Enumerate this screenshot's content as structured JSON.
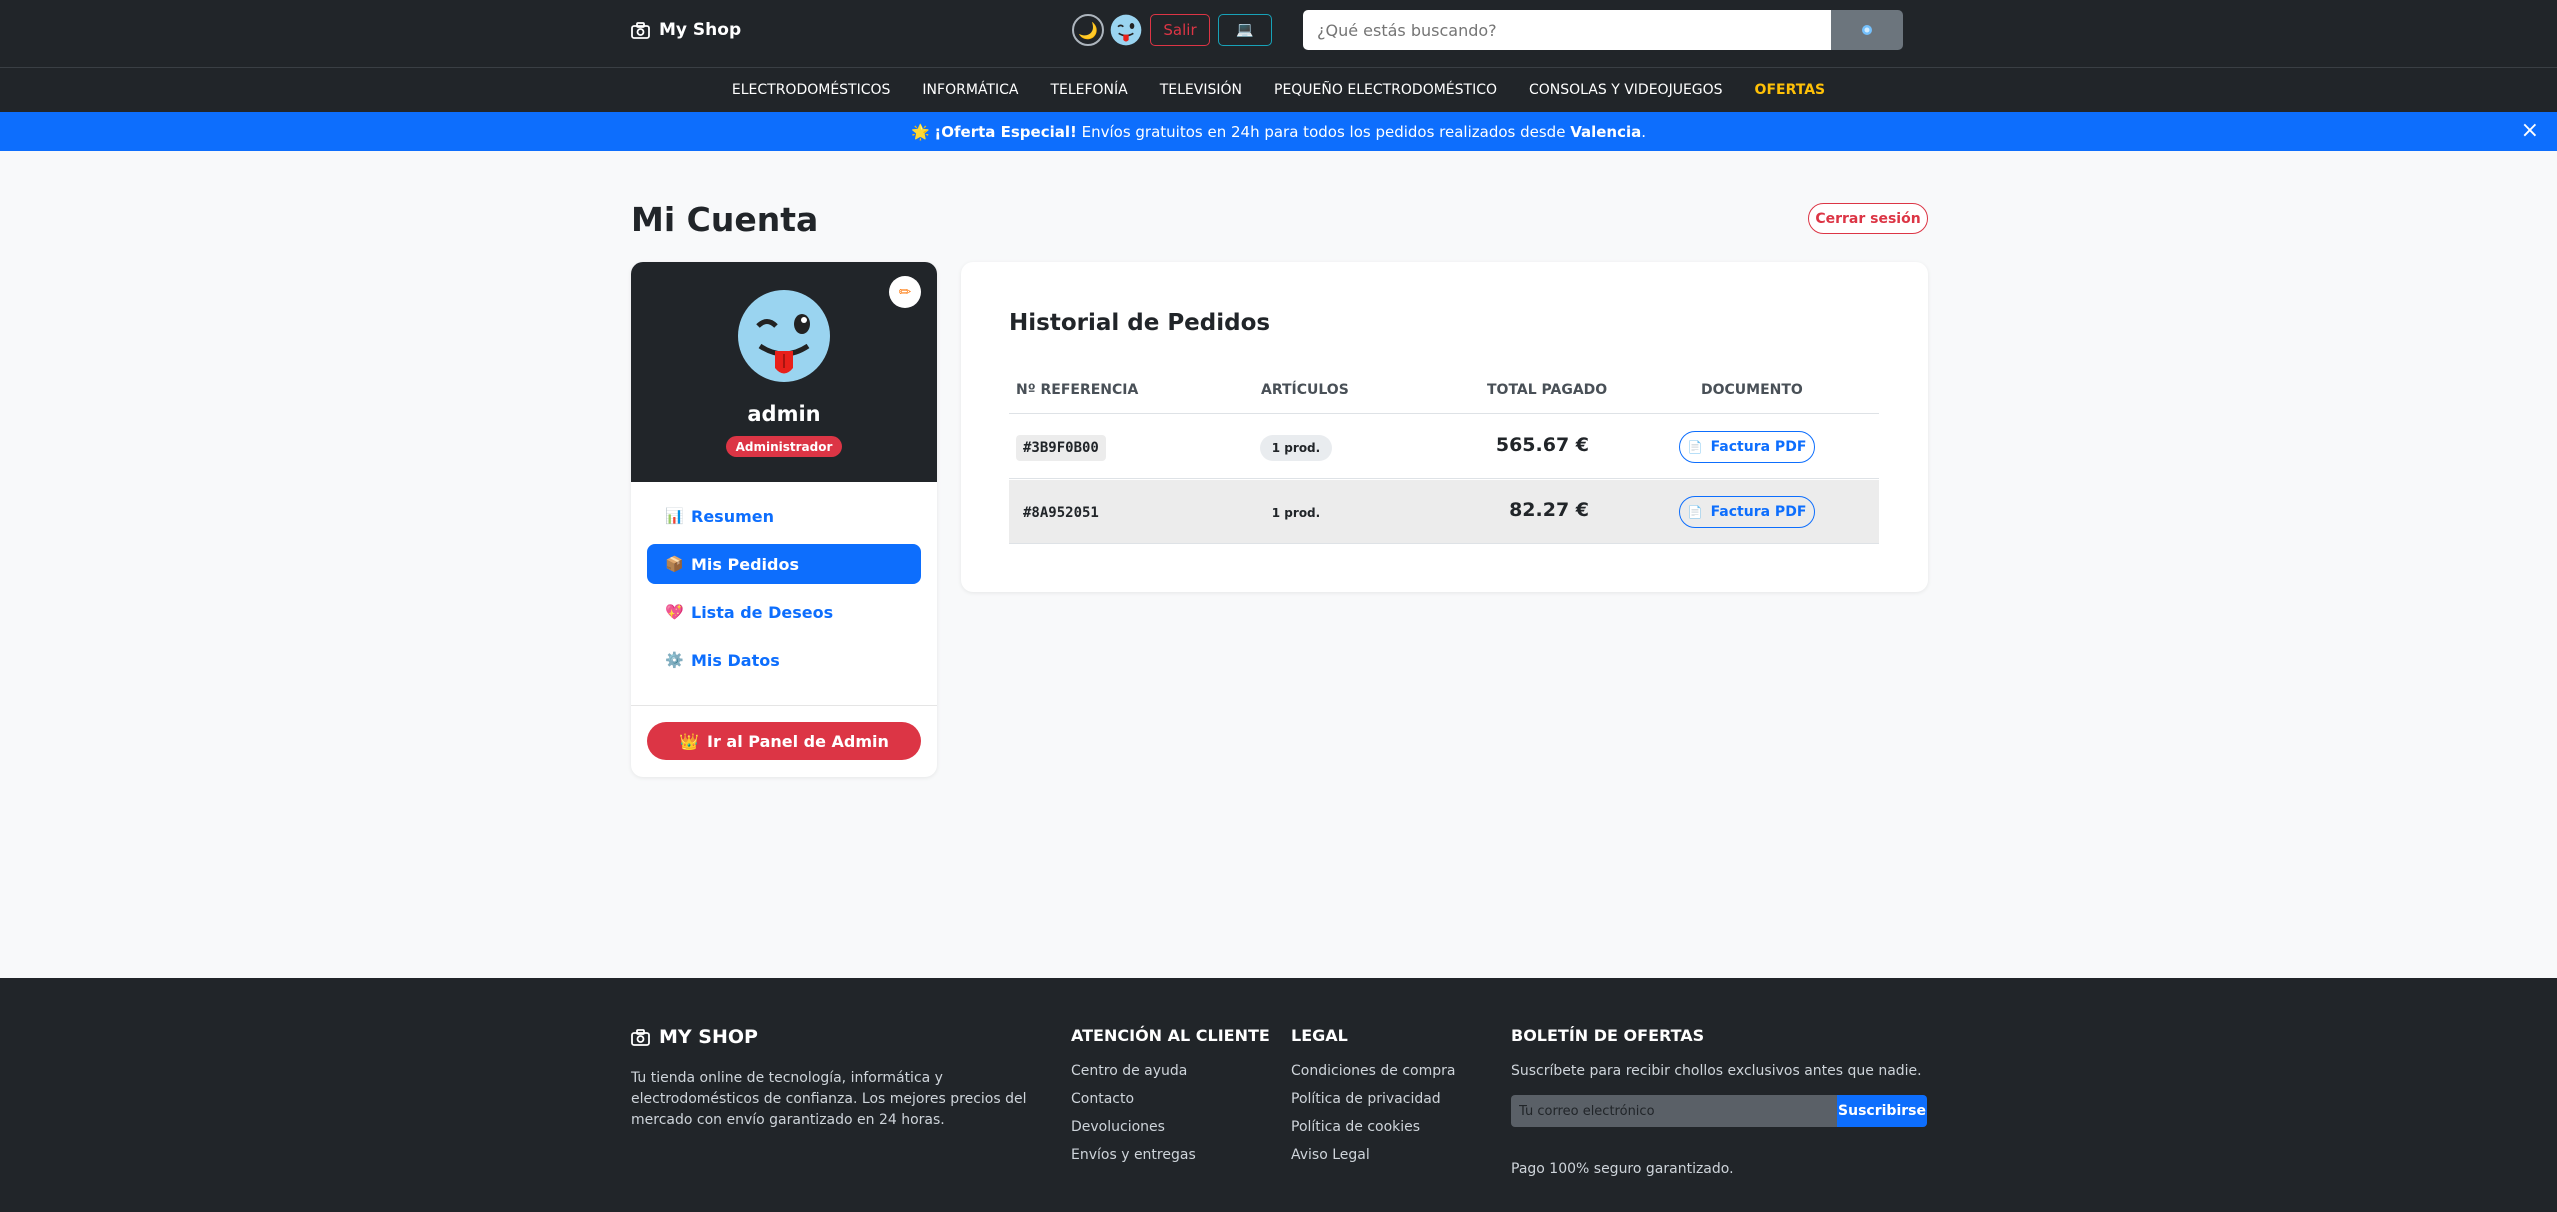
{
  "header": {
    "brand": "My Shop",
    "moon_icon": "🌙",
    "logout_label": "Salir",
    "monitor_icon": "💻",
    "search_placeholder": "¿Qué estás buscando?"
  },
  "nav": {
    "items": [
      "ELECTRODOMÉSTICOS",
      "INFORMÁTICA",
      "TELEFONÍA",
      "TELEVISIÓN",
      "PEQUEÑO ELECTRODOMÉSTICO",
      "CONSOLAS Y VIDEOJUEGOS"
    ],
    "offers": "OFERTAS"
  },
  "promo": {
    "icon": "🌟",
    "bold": "¡Oferta Especial!",
    "text": " Envíos gratuitos en 24h para todos los pedidos realizados desde ",
    "city": "Valencia",
    "end": ".",
    "close": "×"
  },
  "page": {
    "title": "Mi Cuenta",
    "logout_label": "Cerrar sesión"
  },
  "profile": {
    "edit_icon": "✏",
    "username": "admin",
    "role": "Administrador",
    "menu": [
      {
        "icon": "📊",
        "label": "Resumen"
      },
      {
        "icon": "📦",
        "label": "Mis Pedidos"
      },
      {
        "icon": "💖",
        "label": "Lista de Deseos"
      },
      {
        "icon": "⚙️",
        "label": "Mis Datos"
      }
    ],
    "admin_icon": "👑",
    "admin_label": "Ir al Panel de Admin"
  },
  "orders": {
    "title": "Historial de Pedidos",
    "headers": [
      "Nº REFERENCIA",
      "ARTÍCULOS",
      "TOTAL PAGADO",
      "DOCUMENTO"
    ],
    "rows": [
      {
        "ref": "#3B9F0B00",
        "items": "1 prod.",
        "total": "565.67 €",
        "doc": "Factura PDF"
      },
      {
        "ref": "#8A952051",
        "items": "1 prod.",
        "total": "82.27 €",
        "doc": "Factura PDF"
      }
    ],
    "doc_icon": "📄"
  },
  "footer": {
    "brand": "MY SHOP",
    "description": "Tu tienda online de tecnología, informática y electrodomésticos de confianza. Los mejores precios del mercado con envío garantizado en 24 horas.",
    "support_title": "ATENCIÓN AL CLIENTE",
    "support_links": [
      "Centro de ayuda",
      "Contacto",
      "Devoluciones",
      "Envíos y entregas"
    ],
    "legal_title": "LEGAL",
    "legal_links": [
      "Condiciones de compra",
      "Política de privacidad",
      "Política de cookies",
      "Aviso Legal"
    ],
    "newsletter_title": "BOLETÍN DE OFERTAS",
    "newsletter_text": "Suscríbete para recibir chollos exclusivos antes que nadie.",
    "email_placeholder": "Tu correo electrónico",
    "subscribe_label": "Suscribirse",
    "secure_text": "Pago 100% seguro garantizado."
  }
}
